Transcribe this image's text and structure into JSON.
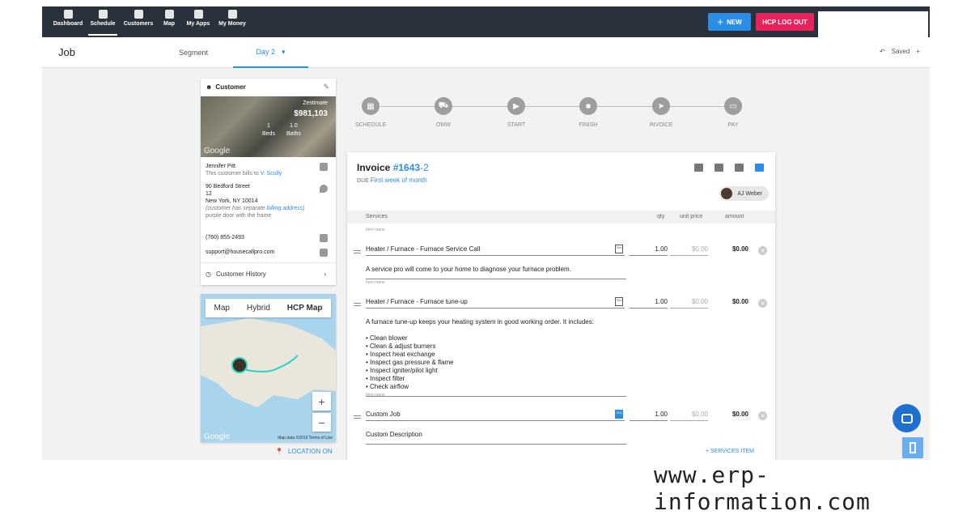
{
  "nav": {
    "items": [
      {
        "label": "Dashboard",
        "icon": "gauge-icon"
      },
      {
        "label": "Schedule",
        "icon": "calendar-icon"
      },
      {
        "label": "Customers",
        "icon": "people-icon"
      },
      {
        "label": "Map",
        "icon": "person-pin-icon"
      },
      {
        "label": "My Apps",
        "icon": "grid-icon"
      },
      {
        "label": "My Money",
        "icon": "dollar-icon"
      }
    ],
    "active": "Schedule",
    "new_label": "NEW",
    "logout_label": "HCP LOG OUT"
  },
  "subheader": {
    "title": "Job",
    "tab_segment": "Segment",
    "tab_day": "Day 2",
    "saved": "Saved"
  },
  "customer": {
    "header": "Customer",
    "zestimate_label": "Zestimate",
    "zestimate_value": "$981,103",
    "beds_value": "1",
    "beds_label": "Beds",
    "baths_value": "1.0",
    "baths_label": "Baths",
    "photo_logo": "Google",
    "name": "Jennifer Pitt",
    "bills_prefix": "This customer bills to",
    "bills_to": "V. Scully",
    "address_line1": "90 Bedford Street",
    "address_line2": "12",
    "address_line3": "New York, NY 10014",
    "address_note_prefix": "(customer has separate",
    "address_note_link": "billing address",
    "address_note_suffix": ")",
    "address_note2": "purple door with the frame",
    "phone": "(760) 855-2493",
    "email": "support@housecallpro.com",
    "history_label": "Customer History"
  },
  "map": {
    "tabs": [
      "Map",
      "Hybrid",
      "HCP Map"
    ],
    "active_tab": "HCP Map",
    "zoom_in": "+",
    "zoom_out": "−",
    "footer": "Map data ©2019   Terms of Use",
    "logo": "Google",
    "location_label": "LOCATION ON"
  },
  "steps": [
    {
      "label": "SCHEDULE",
      "icon": "calendar-icon"
    },
    {
      "label": "OMW",
      "icon": "truck-icon"
    },
    {
      "label": "START",
      "icon": "play-icon"
    },
    {
      "label": "FINISH",
      "icon": "stop-icon"
    },
    {
      "label": "INVOICE",
      "icon": "send-icon"
    },
    {
      "label": "PAY",
      "icon": "card-icon"
    }
  ],
  "invoice": {
    "title": "Invoice",
    "number": "#1643",
    "suffix": "-2",
    "due_label": "DUE",
    "due_value": "First week of month",
    "assignee": "AJ Weber",
    "headers": {
      "services": "Services",
      "qty": "qty",
      "unit_price": "unit price",
      "amount": "amount"
    },
    "item_name_label": "Item name",
    "tax_label": "TAX",
    "items": [
      {
        "name": "Heater / Furnace - Furnace Service Call",
        "qty": "1.00",
        "unit_price": "$0.00",
        "amount": "$0.00",
        "taxed": false,
        "description": "A service pro will come to your home to diagnose your furnace problem."
      },
      {
        "name": "Heater / Furnace - Furnace tune-up",
        "qty": "1.00",
        "unit_price": "$0.00",
        "amount": "$0.00",
        "taxed": false,
        "description": "A furnace tune-up keeps your heating system in good working order. It includes:\n\n• Clean blower\n• Clean & adjust burners\n• Inspect heat exchange\n• Inspect gas pressure & flame\n• Inspect igniter/pilot light\n• Inspect filter\n• Check airflow"
      },
      {
        "name": "Custom Job",
        "qty": "1.00",
        "unit_price": "$0.00",
        "amount": "$0.00",
        "taxed": true,
        "description": "Custom Description"
      }
    ],
    "add_service_label": "+ SERVICES ITEM"
  },
  "watermark": "www.erp-information.com"
}
